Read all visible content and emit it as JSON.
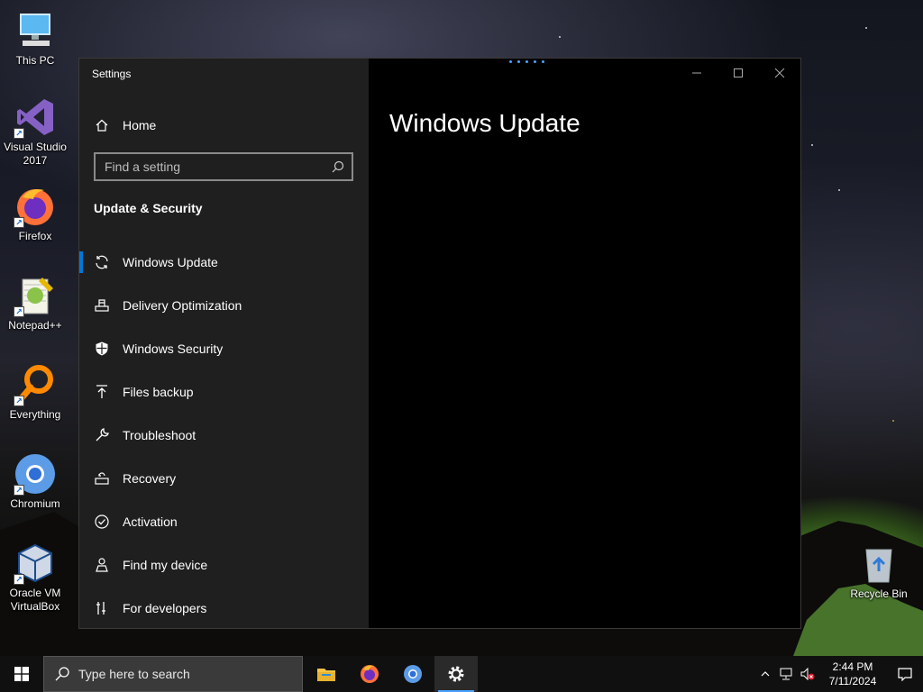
{
  "desktop": {
    "icons": [
      {
        "label": "This PC"
      },
      {
        "label": "Visual Studio 2017"
      },
      {
        "label": "Firefox"
      },
      {
        "label": "Notepad++"
      },
      {
        "label": "Everything"
      },
      {
        "label": "Chromium"
      },
      {
        "label": "Oracle VM VirtualBox"
      },
      {
        "label": "Recycle Bin"
      }
    ]
  },
  "window": {
    "app_title": "Settings",
    "controls": {
      "minimize_icon": "minimize-icon",
      "maximize_icon": "maximize-icon",
      "close_icon": "close-icon"
    },
    "home_label": "Home",
    "search": {
      "placeholder": "Find a setting",
      "value": ""
    },
    "section_title": "Update & Security",
    "nav_items": [
      {
        "label": "Windows Update",
        "icon": "sync-icon",
        "active": true
      },
      {
        "label": "Delivery Optimization",
        "icon": "delivery-icon",
        "active": false
      },
      {
        "label": "Windows Security",
        "icon": "shield-icon",
        "active": false
      },
      {
        "label": "Files backup",
        "icon": "upload-arrow-icon",
        "active": false
      },
      {
        "label": "Troubleshoot",
        "icon": "wrench-icon",
        "active": false
      },
      {
        "label": "Recovery",
        "icon": "recovery-icon",
        "active": false
      },
      {
        "label": "Activation",
        "icon": "check-circle-icon",
        "active": false
      },
      {
        "label": "Find my device",
        "icon": "person-pin-icon",
        "active": false
      },
      {
        "label": "For developers",
        "icon": "developer-icon",
        "active": false
      }
    ],
    "page_title": "Windows Update"
  },
  "taskbar": {
    "search_placeholder": "Type here to search",
    "apps": [
      "File Explorer",
      "Firefox",
      "Chromium",
      "Settings"
    ],
    "time": "2:44 PM",
    "date": "7/11/2024"
  },
  "colors": {
    "accent": "#0078d7",
    "sidebar_bg": "#1f1f1f",
    "content_bg": "#000000"
  }
}
